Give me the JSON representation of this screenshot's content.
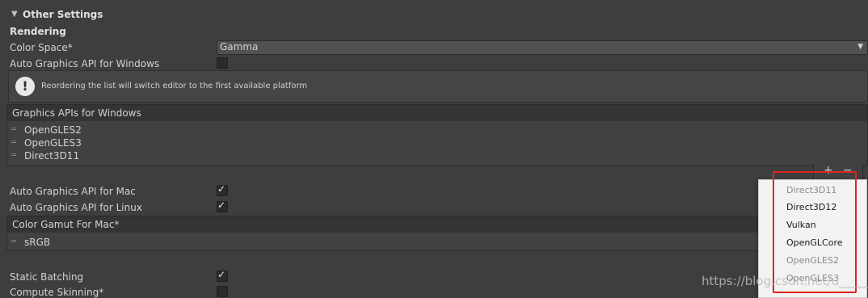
{
  "section": {
    "title": "Other Settings",
    "subsection": "Rendering"
  },
  "color_space": {
    "label": "Color Space*",
    "value": "Gamma"
  },
  "auto_api_windows": {
    "label": "Auto Graphics API  for Windows",
    "checked": false
  },
  "help": {
    "message": "Reordering the list will switch editor to the first available platform"
  },
  "windows_list": {
    "header": "Graphics APIs for Windows",
    "items": [
      "OpenGLES2",
      "OpenGLES3",
      "Direct3D11"
    ]
  },
  "list_buttons": {
    "plus": "+",
    "minus": "−"
  },
  "auto_api_mac": {
    "label": "Auto Graphics API  for Mac",
    "checked": true
  },
  "auto_api_linux": {
    "label": "Auto Graphics API  for Linux",
    "checked": true
  },
  "gamut_list": {
    "header": "Color Gamut For Mac*",
    "items": [
      "sRGB"
    ]
  },
  "static_batching": {
    "label": "Static Batching",
    "checked": true
  },
  "compute_skinning": {
    "label": "Compute Skinning*",
    "checked": false
  },
  "popup": {
    "items": [
      {
        "label": "Direct3D11",
        "enabled": false
      },
      {
        "label": "Direct3D12",
        "enabled": true
      },
      {
        "label": "Vulkan",
        "enabled": true
      },
      {
        "label": "OpenGLCore",
        "enabled": true
      },
      {
        "label": "OpenGLES2",
        "enabled": false
      },
      {
        "label": "OpenGLES3",
        "enabled": false
      }
    ]
  },
  "watermark": "https://blog.csdn.net/u_____20",
  "colors": {
    "highlight": "#e1241c",
    "background": "#3e3e3e"
  }
}
